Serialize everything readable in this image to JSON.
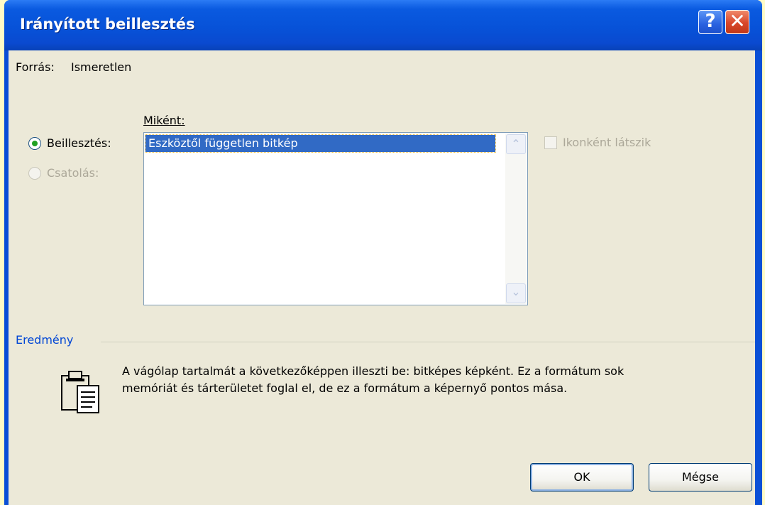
{
  "window": {
    "title": "Irányított beillesztés",
    "help_button": "?",
    "close_button": "✕"
  },
  "source": {
    "label": "Forrás:",
    "value": "Ismeretlen"
  },
  "paste_options": {
    "as_label": "Miként:",
    "paste_radio": {
      "label": "Beillesztés:",
      "checked": true,
      "enabled": true
    },
    "link_radio": {
      "label": "Csatolás:",
      "checked": false,
      "enabled": false
    },
    "formats": [
      {
        "label": "Eszköztől független bitkép",
        "selected": true
      }
    ],
    "display_as_icon": {
      "label": "Ikonként látszik",
      "checked": false,
      "enabled": false
    }
  },
  "result": {
    "group_label": "Eredmény",
    "line1": "A vágólap tartalmát a következőképpen illeszti be: bitképes képként.  Ez a formátum sok",
    "line2": "memóriát és tárterületet foglal el, de ez a formátum a képernyő pontos mása.",
    "icon": "clipboard-paste-icon"
  },
  "buttons": {
    "ok": "OK",
    "cancel": "Mégse"
  },
  "colors": {
    "titlebar": "#0752d8",
    "dialog_face": "#ece9d8",
    "selection": "#316ac5",
    "group_title": "#0046d5",
    "desktop": "#fffbc6"
  }
}
